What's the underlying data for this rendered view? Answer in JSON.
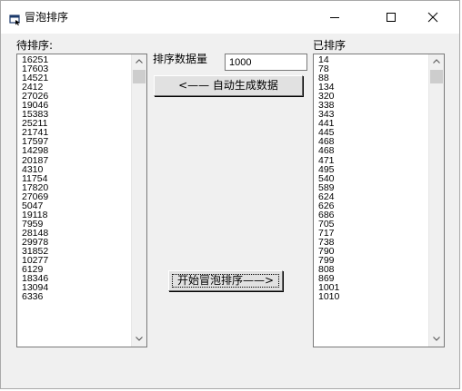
{
  "window": {
    "title": "冒泡排序",
    "icon": "app-window-icon",
    "controls": [
      "minimize-icon",
      "maximize-icon",
      "close-icon"
    ]
  },
  "unsorted": {
    "label": "待排序:",
    "items": [
      "16251",
      "17603",
      "14521",
      "2412",
      "27026",
      "19046",
      "15383",
      "25211",
      "21741",
      "17597",
      "14298",
      "20187",
      "4310",
      "11754",
      "17820",
      "27069",
      "5047",
      "19118",
      "7959",
      "28148",
      "29978",
      "31852",
      "10277",
      "6129",
      "18346",
      "13094",
      "6336"
    ]
  },
  "sorted": {
    "label": "已排序",
    "items": [
      "14",
      "78",
      "88",
      "134",
      "320",
      "338",
      "343",
      "441",
      "445",
      "468",
      "468",
      "471",
      "495",
      "540",
      "589",
      "624",
      "626",
      "686",
      "705",
      "717",
      "738",
      "790",
      "799",
      "808",
      "869",
      "1001",
      "1010"
    ]
  },
  "count": {
    "label": "排序数据量",
    "value": "1000"
  },
  "buttons": {
    "generate": "<—— 自动生成数据",
    "start_sort": "开始冒泡排序——>"
  },
  "colors": {
    "window_bg": "#f0f0f0",
    "titlebar_bg": "#ffffff",
    "scroll_thumb": "#cdcdcd"
  }
}
